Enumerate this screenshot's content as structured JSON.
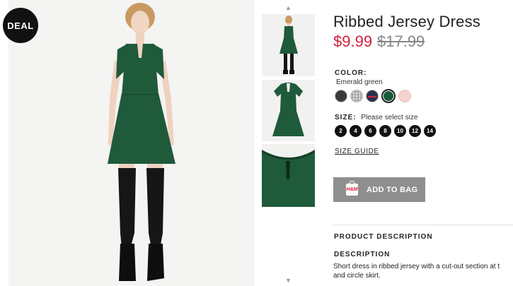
{
  "deal_badge": "DEAL",
  "product": {
    "title": "Ribbed Jersey Dress",
    "price_current": "$9.99",
    "price_original": "$17.99"
  },
  "color": {
    "label": "COLOR:",
    "selected_name": "Emerald green",
    "swatches": [
      {
        "name": "dark-grey",
        "color": "#3a3a3a"
      },
      {
        "name": "grey-pattern",
        "color": "#b9b9b9"
      },
      {
        "name": "navy-stripe",
        "color": "#2b2f4f"
      },
      {
        "name": "emerald-green",
        "color": "#1c5a3f"
      },
      {
        "name": "light-pink",
        "color": "#f4d3cc"
      }
    ]
  },
  "size": {
    "label": "SIZE:",
    "hint": "Please select size",
    "options": [
      "2",
      "4",
      "6",
      "8",
      "10",
      "12",
      "14"
    ],
    "guide_label": "SIZE GUIDE"
  },
  "add_to_bag": {
    "label": "ADD TO BAG",
    "icon": "shopping-bag-icon",
    "icon_text": "H&M"
  },
  "description": {
    "section_title": "PRODUCT DESCRIPTION",
    "heading": "DESCRIPTION",
    "lines": [
      "Short dress in ribbed jersey with a cut-out section at t",
      "and circle skirt."
    ]
  },
  "thumbnails": {
    "arrow_up": "▲",
    "arrow_down": "▼"
  },
  "colors": {
    "dress": "#1f5a3b",
    "price_sale": "#d0203a",
    "button": "#8f8f8f"
  }
}
